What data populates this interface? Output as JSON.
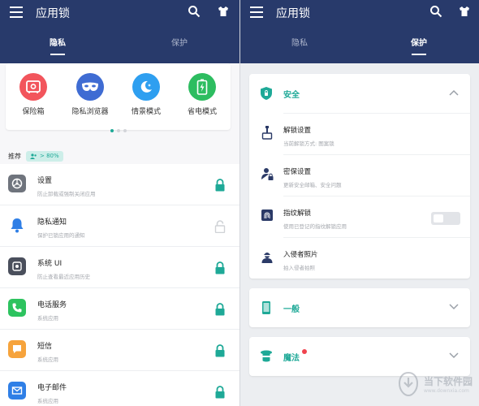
{
  "app_title": "应用锁",
  "tabs": [
    "隐私",
    "保护"
  ],
  "colors": {
    "appbar": "#283a6b",
    "accent": "#1ea997",
    "alert": "#f0434e"
  },
  "quick_actions": [
    {
      "label": "保险箱",
      "icon": "safe-icon",
      "color": "#f2555c"
    },
    {
      "label": "隐私浏览器",
      "icon": "mask-icon",
      "color": "#3f6cd3"
    },
    {
      "label": "情景模式",
      "icon": "moon-icon",
      "color": "#2e9ff0"
    },
    {
      "label": "省电模式",
      "icon": "battery-icon",
      "color": "#2dbd60"
    }
  ],
  "recommend": {
    "title": "推荐",
    "badge": "> 80%"
  },
  "apps": [
    {
      "name": "设置",
      "desc": "防止卸载或强制关闭应用",
      "icon": "settings-icon",
      "locked": true
    },
    {
      "name": "隐私通知",
      "desc": "保护已锁应用的通知",
      "icon": "bell-icon",
      "locked": false
    },
    {
      "name": "系统 UI",
      "desc": "防止查看最近应用历史",
      "icon": "system-ui-icon",
      "locked": true
    },
    {
      "name": "电话服务",
      "desc": "系统应用",
      "icon": "phone-icon",
      "locked": true
    },
    {
      "name": "短信",
      "desc": "系统应用",
      "icon": "message-icon",
      "locked": true
    },
    {
      "name": "电子邮件",
      "desc": "系统应用",
      "icon": "mail-icon",
      "locked": true
    }
  ],
  "security": {
    "title": "安全",
    "items": [
      {
        "name": "解锁设置",
        "desc": "当前解锁方式: 图案锁",
        "icon": "unlock-settings-icon"
      },
      {
        "name": "密保设置",
        "desc": "更新安全邮箱、安全问题",
        "icon": "password-protect-icon"
      },
      {
        "name": "指纹解锁",
        "desc": "使用已登记的指纹解锁应用",
        "icon": "fingerprint-icon",
        "toggle_on": false
      },
      {
        "name": "入侵者照片",
        "desc": "拍入侵者拍照",
        "icon": "intruder-icon"
      }
    ]
  },
  "general": {
    "title": "一般"
  },
  "magic": {
    "title": "魔法"
  },
  "watermark": {
    "cn": "当下软件园",
    "en": "www.downxia.com"
  }
}
